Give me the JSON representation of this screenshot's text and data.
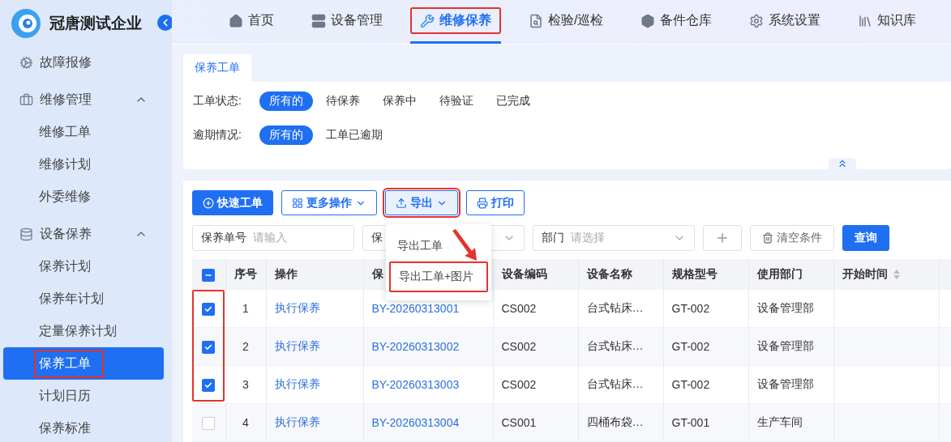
{
  "sidebar": {
    "brand": "冠唐测试企业",
    "items": [
      {
        "label": "故障报修",
        "kind": "link",
        "selected": false
      },
      {
        "label": "维修管理",
        "kind": "group",
        "expanded": true,
        "children": [
          {
            "label": "维修工单",
            "selected": false
          },
          {
            "label": "维修计划",
            "selected": false
          },
          {
            "label": "外委维修",
            "selected": false
          }
        ]
      },
      {
        "label": "设备保养",
        "kind": "group",
        "expanded": true,
        "children": [
          {
            "label": "保养计划",
            "selected": false
          },
          {
            "label": "保养年计划",
            "selected": false
          },
          {
            "label": "定量保养计划",
            "selected": false
          },
          {
            "label": "保养工单",
            "selected": true,
            "highlighted": true
          },
          {
            "label": "计划日历",
            "selected": false
          },
          {
            "label": "保养标准",
            "selected": false
          }
        ]
      }
    ]
  },
  "nav": [
    {
      "label": "首页",
      "selected": false,
      "highlighted": false
    },
    {
      "label": "设备管理",
      "selected": false,
      "highlighted": false
    },
    {
      "label": "维修保养",
      "selected": true,
      "highlighted": true
    },
    {
      "label": "检验/巡检",
      "selected": false,
      "highlighted": false
    },
    {
      "label": "备件仓库",
      "selected": false,
      "highlighted": false
    },
    {
      "label": "系统设置",
      "selected": false,
      "highlighted": false
    },
    {
      "label": "知识库",
      "selected": false,
      "highlighted": false
    }
  ],
  "page_tabs": [
    {
      "label": "保养工单",
      "selected": true
    }
  ],
  "filters": [
    {
      "label": "工单状态:",
      "options": [
        {
          "label": "所有的",
          "selected": true
        },
        {
          "label": "待保养",
          "selected": false
        },
        {
          "label": "保养中",
          "selected": false
        },
        {
          "label": "待验证",
          "selected": false
        },
        {
          "label": "已完成",
          "selected": false
        }
      ]
    },
    {
      "label": "逾期情况:",
      "options": [
        {
          "label": "所有的",
          "selected": true
        },
        {
          "label": "工单已逾期",
          "selected": false
        }
      ]
    }
  ],
  "toolbar": [
    {
      "label": "快速工单",
      "kind": "primary",
      "highlighted": false
    },
    {
      "label": "更多操作",
      "kind": "menu",
      "highlighted": false
    },
    {
      "label": "导出",
      "kind": "export",
      "highlighted": true
    },
    {
      "label": "打印",
      "kind": "print",
      "highlighted": false
    }
  ],
  "export_menu": {
    "items": [
      {
        "label": "导出工单",
        "highlighted": false
      },
      {
        "label": "导出工单+图片",
        "highlighted": true
      }
    ],
    "arrow": true
  },
  "search_fields": [
    {
      "label": "保养单号",
      "placeholder": "请输入",
      "kind": "input"
    },
    {
      "label": "保",
      "kind": "select"
    },
    {
      "label": "部门",
      "placeholder": "请选择",
      "kind": "select"
    }
  ],
  "search_buttons": [
    {
      "kind": "add"
    },
    {
      "label": "清空条件",
      "kind": "clear"
    },
    {
      "label": "查询",
      "kind": "query"
    }
  ],
  "table": {
    "indeterminate": true,
    "checkbox_highlight": true,
    "columns": [
      {
        "label": "序号"
      },
      {
        "label": "操作"
      },
      {
        "label": "保"
      },
      {
        "label": "设备编码"
      },
      {
        "label": "设备名称"
      },
      {
        "label": "规格型号"
      },
      {
        "label": "使用部门"
      },
      {
        "label": "开始时间",
        "sortable": true
      }
    ],
    "rows": [
      {
        "checked": true,
        "cells": [
          "1",
          "执行保养",
          "BY-20260313001",
          "CS002",
          "台式钻床…",
          "GT-002",
          "设备管理部"
        ]
      },
      {
        "checked": true,
        "cells": [
          "2",
          "执行保养",
          "BY-20260313002",
          "CS002",
          "台式钻床…",
          "GT-002",
          "设备管理部"
        ]
      },
      {
        "checked": true,
        "cells": [
          "3",
          "执行保养",
          "BY-20260313003",
          "CS002",
          "台式钻床…",
          "GT-002",
          "设备管理部"
        ]
      },
      {
        "checked": false,
        "cells": [
          "4",
          "执行保养",
          "BY-20260313004",
          "CS001",
          "四桶布袋…",
          "GT-001",
          "生产车间"
        ]
      }
    ]
  }
}
